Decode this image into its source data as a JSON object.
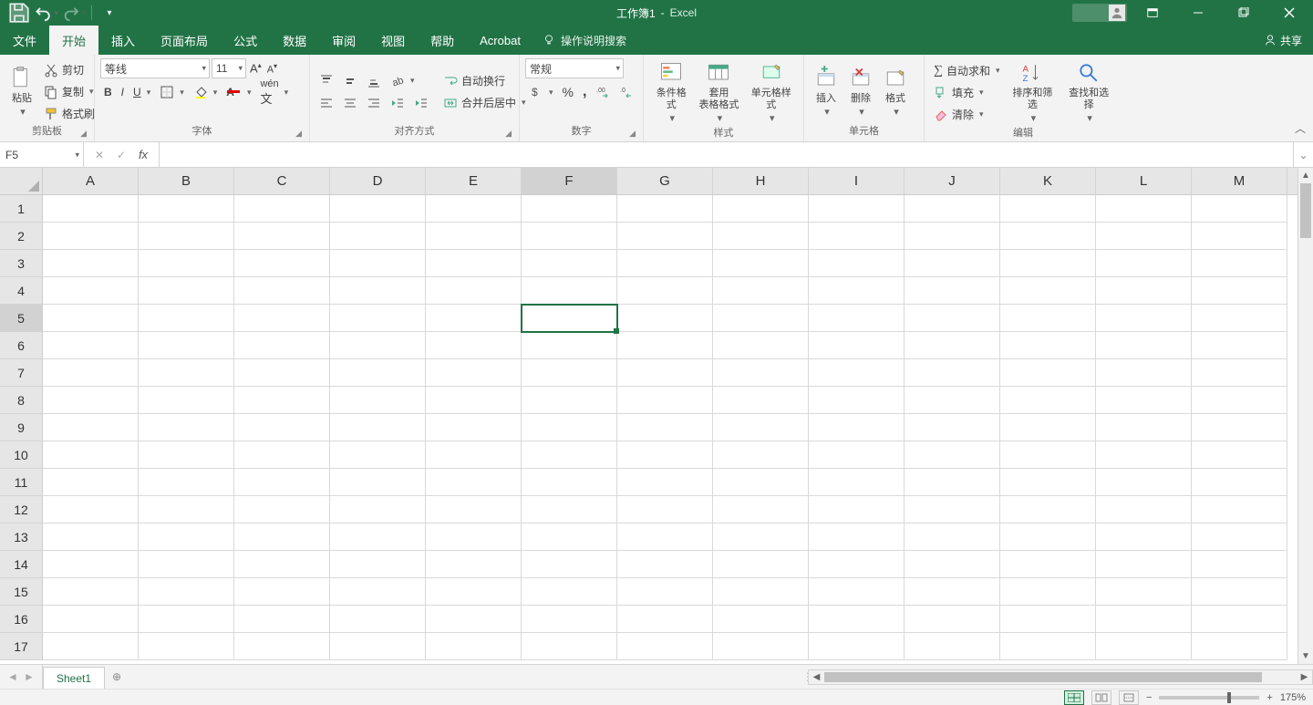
{
  "title": {
    "doc": "工作簿1",
    "sep": " - ",
    "app": "Excel"
  },
  "tabs": {
    "file": "文件",
    "home": "开始",
    "insert": "插入",
    "layout": "页面布局",
    "formulas": "公式",
    "data": "数据",
    "review": "审阅",
    "view": "视图",
    "help": "帮助",
    "acrobat": "Acrobat",
    "tellme": "操作说明搜索",
    "share": "共享"
  },
  "ribbon": {
    "clipboard": {
      "label": "剪贴板",
      "paste": "粘贴",
      "cut": "剪切",
      "copy": "复制",
      "painter": "格式刷"
    },
    "font": {
      "label": "字体",
      "name": "等线",
      "size": "11",
      "bold": "B",
      "italic": "I",
      "underline": "U"
    },
    "align": {
      "label": "对齐方式",
      "wrap": "自动换行",
      "merge": "合并后居中"
    },
    "number": {
      "label": "数字",
      "format": "常规",
      "percent": "%",
      "comma": ","
    },
    "styles": {
      "label": "样式",
      "cond": "条件格式",
      "table": "套用\n表格格式",
      "cell": "单元格样式"
    },
    "cells": {
      "label": "单元格",
      "insert": "插入",
      "delete": "删除",
      "format": "格式"
    },
    "editing": {
      "label": "编辑",
      "sum": "自动求和",
      "fill": "填充",
      "clear": "清除",
      "sort": "排序和筛选",
      "find": "查找和选择"
    }
  },
  "formula_bar": {
    "namebox": "F5",
    "formula": ""
  },
  "grid": {
    "columns": [
      "A",
      "B",
      "C",
      "D",
      "E",
      "F",
      "G",
      "H",
      "I",
      "J",
      "K",
      "L",
      "M"
    ],
    "rows": [
      "1",
      "2",
      "3",
      "4",
      "5",
      "6",
      "7",
      "8",
      "9",
      "10",
      "11",
      "12",
      "13",
      "14",
      "15",
      "16",
      "17"
    ],
    "active_col": "F",
    "active_row": "5"
  },
  "sheetbar": {
    "sheet": "Sheet1"
  },
  "status": {
    "zoom": "175%"
  }
}
